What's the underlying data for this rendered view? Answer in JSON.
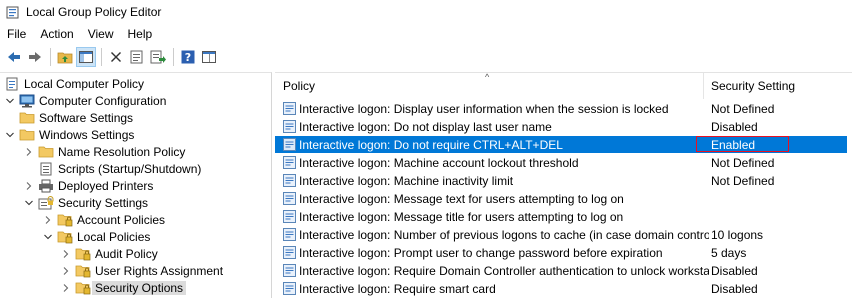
{
  "window": {
    "title": "Local Group Policy Editor"
  },
  "menu": [
    "File",
    "Action",
    "View",
    "Help"
  ],
  "toolbar": [
    {
      "icon": "back-arrow-icon"
    },
    {
      "icon": "forward-arrow-icon"
    },
    {
      "icon": "up-folder-icon"
    },
    {
      "icon": "show-hide-tree-icon"
    },
    {
      "icon": "delete-icon"
    },
    {
      "icon": "properties-icon"
    },
    {
      "icon": "export-list-icon"
    },
    {
      "icon": "help-icon"
    },
    {
      "icon": "extended-view-icon"
    }
  ],
  "tree": [
    {
      "label": "Local Computer Policy",
      "level": 0,
      "expand": "none",
      "icon": "policy-scroll-icon"
    },
    {
      "label": "Computer Configuration",
      "level": 0,
      "expand": "down",
      "icon": "computer-icon"
    },
    {
      "label": "Software Settings",
      "level": 1,
      "expand": "none",
      "icon": "folder-icon"
    },
    {
      "label": "Windows Settings",
      "level": 1,
      "expand": "down",
      "icon": "folder-icon"
    },
    {
      "label": "Name Resolution Policy",
      "level": 2,
      "expand": "right",
      "icon": "folder-icon"
    },
    {
      "label": "Scripts (Startup/Shutdown)",
      "level": 2,
      "expand": "none",
      "icon": "script-icon"
    },
    {
      "label": "Deployed Printers",
      "level": 2,
      "expand": "right",
      "icon": "printer-icon"
    },
    {
      "label": "Security Settings",
      "level": 2,
      "expand": "down",
      "icon": "security-icon"
    },
    {
      "label": "Account Policies",
      "level": 3,
      "expand": "right",
      "icon": "locked-folder-icon"
    },
    {
      "label": "Local Policies",
      "level": 3,
      "expand": "down",
      "icon": "locked-folder-icon"
    },
    {
      "label": "Audit Policy",
      "level": 4,
      "expand": "right",
      "icon": "locked-folder-icon"
    },
    {
      "label": "User Rights Assignment",
      "level": 4,
      "expand": "right",
      "icon": "locked-folder-icon"
    },
    {
      "label": "Security Options",
      "level": 4,
      "expand": "right",
      "icon": "locked-folder-icon",
      "selected": true
    }
  ],
  "list": {
    "columns": {
      "policy": "Policy",
      "setting": "Security Setting"
    },
    "rows": [
      {
        "policy": "Interactive logon: Display user information when the session is locked",
        "setting": "Not Defined"
      },
      {
        "policy": "Interactive logon: Do not display last user name",
        "setting": "Disabled"
      },
      {
        "policy": "Interactive logon: Do not require CTRL+ALT+DEL",
        "setting": "Enabled",
        "selected": true
      },
      {
        "policy": "Interactive logon: Machine account lockout threshold",
        "setting": "Not Defined"
      },
      {
        "policy": "Interactive logon: Machine inactivity limit",
        "setting": "Not Defined"
      },
      {
        "policy": "Interactive logon: Message text for users attempting to log on",
        "setting": ""
      },
      {
        "policy": "Interactive logon: Message title for users attempting to log on",
        "setting": ""
      },
      {
        "policy": "Interactive logon: Number of previous logons to cache (in case domain controll...",
        "setting": "10 logons"
      },
      {
        "policy": "Interactive logon: Prompt user to change password before expiration",
        "setting": "5 days"
      },
      {
        "policy": "Interactive logon: Require Domain Controller authentication to unlock workstati...",
        "setting": "Disabled"
      },
      {
        "policy": "Interactive logon: Require smart card",
        "setting": "Disabled"
      }
    ]
  }
}
